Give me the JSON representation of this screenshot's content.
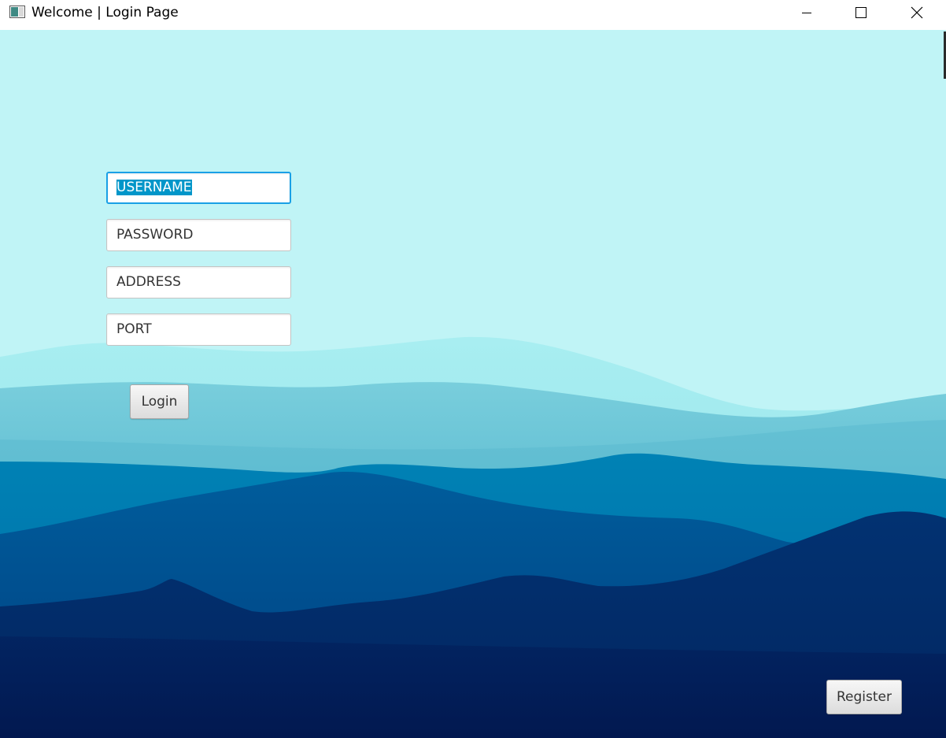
{
  "window": {
    "title": "Welcome | Login Page",
    "icons": {
      "app": "app-window-icon",
      "minimize": "minimize-icon",
      "maximize": "maximize-icon",
      "close": "close-icon"
    }
  },
  "form": {
    "username": {
      "value": "USERNAME",
      "focused": true,
      "selected": true
    },
    "password": {
      "value": "PASSWORD"
    },
    "address": {
      "value": "ADDRESS"
    },
    "port": {
      "value": "PORT"
    },
    "login_label": "Login"
  },
  "footer": {
    "register_label": "Register"
  },
  "colors": {
    "sky": "#c0f4f6",
    "focus_border": "#1aa0e6",
    "selection": "#0096c9",
    "mountain_light": "#0078ad",
    "mountain_mid": "#004f8f",
    "mountain_deep": "#012d6a",
    "mountain_night": "#01124a"
  }
}
